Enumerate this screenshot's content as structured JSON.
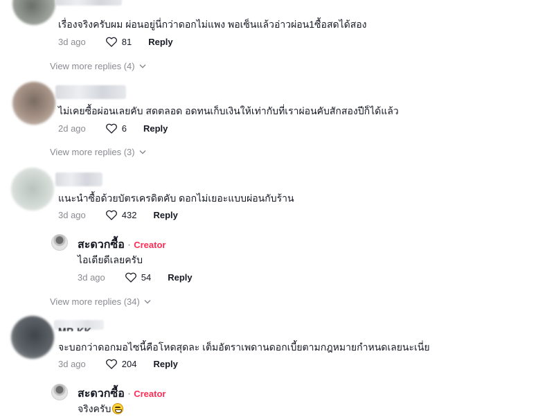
{
  "comments": [
    {
      "text": "เรื่องจริงครับผม ผ่อนอยู่นี่กว่าดอกไม่แพง พอเซ็นแล้วอ่าวผ่อน1ซื้อสดได้สอง",
      "time": "3d ago",
      "likes": "81",
      "reply": "Reply",
      "view_more": "View more replies (4)"
    },
    {
      "text": "ไม่เคยซื้อผ่อนเลยคับ สดตลอด อดทนเก็บเงินให้เท่ากับที่เราผ่อนคับสักสองปีก็ได้แล้ว",
      "time": "2d ago",
      "likes": "6",
      "reply": "Reply",
      "view_more": "View more replies (3)"
    },
    {
      "text": "แนะนำซื้อด้วยบัตรเครดิตคับ ดอกไม่เยอะแบบผ่อนกับร้าน",
      "time": "3d ago",
      "likes": "432",
      "reply": "Reply",
      "creator_reply": {
        "name": "สะดวกซื้อ",
        "tag": "Creator",
        "text": "ไอเดียดีเลยครับ",
        "time": "3d ago",
        "likes": "54",
        "reply": "Reply"
      },
      "view_more": "View more replies (34)"
    },
    {
      "user": "MR.KK",
      "text": "จะบอกว่าดอกมอไซนี้คือโหดสุดละ เต็มอัตราเพดานดอกเบี้ยตามกฎหมายกำหนดเลยนะเนี่ย",
      "time": "3d ago",
      "likes": "204",
      "reply": "Reply",
      "creator_reply": {
        "name": "สะดวกซื้อ",
        "tag": "Creator",
        "text": "จริงครับ"
      }
    }
  ],
  "icons": {
    "like": "heart-outline-icon",
    "expand": "chevron-down-icon"
  },
  "colors": {
    "creator_tag": "#fe2c55",
    "meta": "#8a8b91"
  }
}
